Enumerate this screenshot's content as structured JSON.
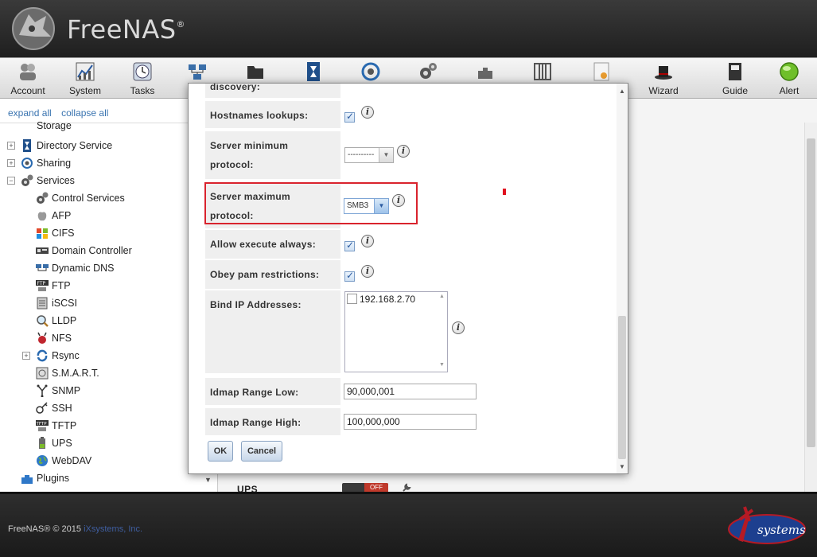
{
  "app": {
    "name": "FreeNAS",
    "trademark": "®"
  },
  "toolbar": {
    "items": [
      {
        "label": "Account",
        "icon": "account-icon"
      },
      {
        "label": "System",
        "icon": "system-icon"
      },
      {
        "label": "Tasks",
        "icon": "tasks-icon"
      },
      {
        "label": "N",
        "icon": "network-icon"
      },
      {
        "label": "",
        "icon": "storage-icon"
      },
      {
        "label": "",
        "icon": "directory-icon"
      },
      {
        "label": "",
        "icon": "sharing-icon"
      },
      {
        "label": "",
        "icon": "services-icon"
      },
      {
        "label": "",
        "icon": "plugins-icon"
      },
      {
        "label": "",
        "icon": "jails-icon"
      },
      {
        "label": "",
        "icon": "reporting-icon"
      },
      {
        "label": "Wizard",
        "icon": "wizard-icon"
      },
      {
        "label": "Guide",
        "icon": "guide-icon"
      },
      {
        "label": "Alert",
        "icon": "alert-icon"
      }
    ]
  },
  "sidebar": {
    "expand_all": "expand all",
    "collapse_all": "collapse all",
    "items": [
      {
        "label": "Storage"
      },
      {
        "label": "Directory Service"
      },
      {
        "label": "Sharing"
      },
      {
        "label": "Services"
      },
      {
        "label": "Control Services"
      },
      {
        "label": "AFP"
      },
      {
        "label": "CIFS"
      },
      {
        "label": "Domain Controller"
      },
      {
        "label": "Dynamic DNS"
      },
      {
        "label": "FTP"
      },
      {
        "label": "iSCSI"
      },
      {
        "label": "LLDP"
      },
      {
        "label": "NFS"
      },
      {
        "label": "Rsync"
      },
      {
        "label": "S.M.A.R.T."
      },
      {
        "label": "SNMP"
      },
      {
        "label": "SSH"
      },
      {
        "label": "TFTP"
      },
      {
        "label": "UPS"
      },
      {
        "label": "WebDAV"
      },
      {
        "label": "Plugins"
      }
    ]
  },
  "main": {
    "ups_label": "UPS",
    "ups_toggle": "OFF"
  },
  "dialog": {
    "partial_label": "discovery:",
    "fields": {
      "hostnames_lookups": {
        "label": "Hostnames lookups:",
        "checked": true
      },
      "server_min": {
        "label_1": "Server minimum",
        "label_2": "protocol:",
        "value": "----------"
      },
      "server_max": {
        "label_1": "Server maximum",
        "label_2": "protocol:",
        "value": "SMB3"
      },
      "allow_execute": {
        "label": "Allow execute always:",
        "checked": true
      },
      "obey_pam": {
        "label": "Obey pam restrictions:",
        "checked": true
      },
      "bind_ip": {
        "label": "Bind IP Addresses:",
        "options": [
          "192.168.2.70"
        ]
      },
      "idmap_low": {
        "label": "Idmap Range Low:",
        "value": "90,000,001"
      },
      "idmap_high": {
        "label": "Idmap Range High:",
        "value": "100,000,000"
      }
    },
    "ok_label": "OK",
    "cancel_label": "Cancel"
  },
  "footer": {
    "copyright": "FreeNAS® © 2015",
    "company": "iXsystems, Inc.",
    "logo_text": "systems"
  }
}
